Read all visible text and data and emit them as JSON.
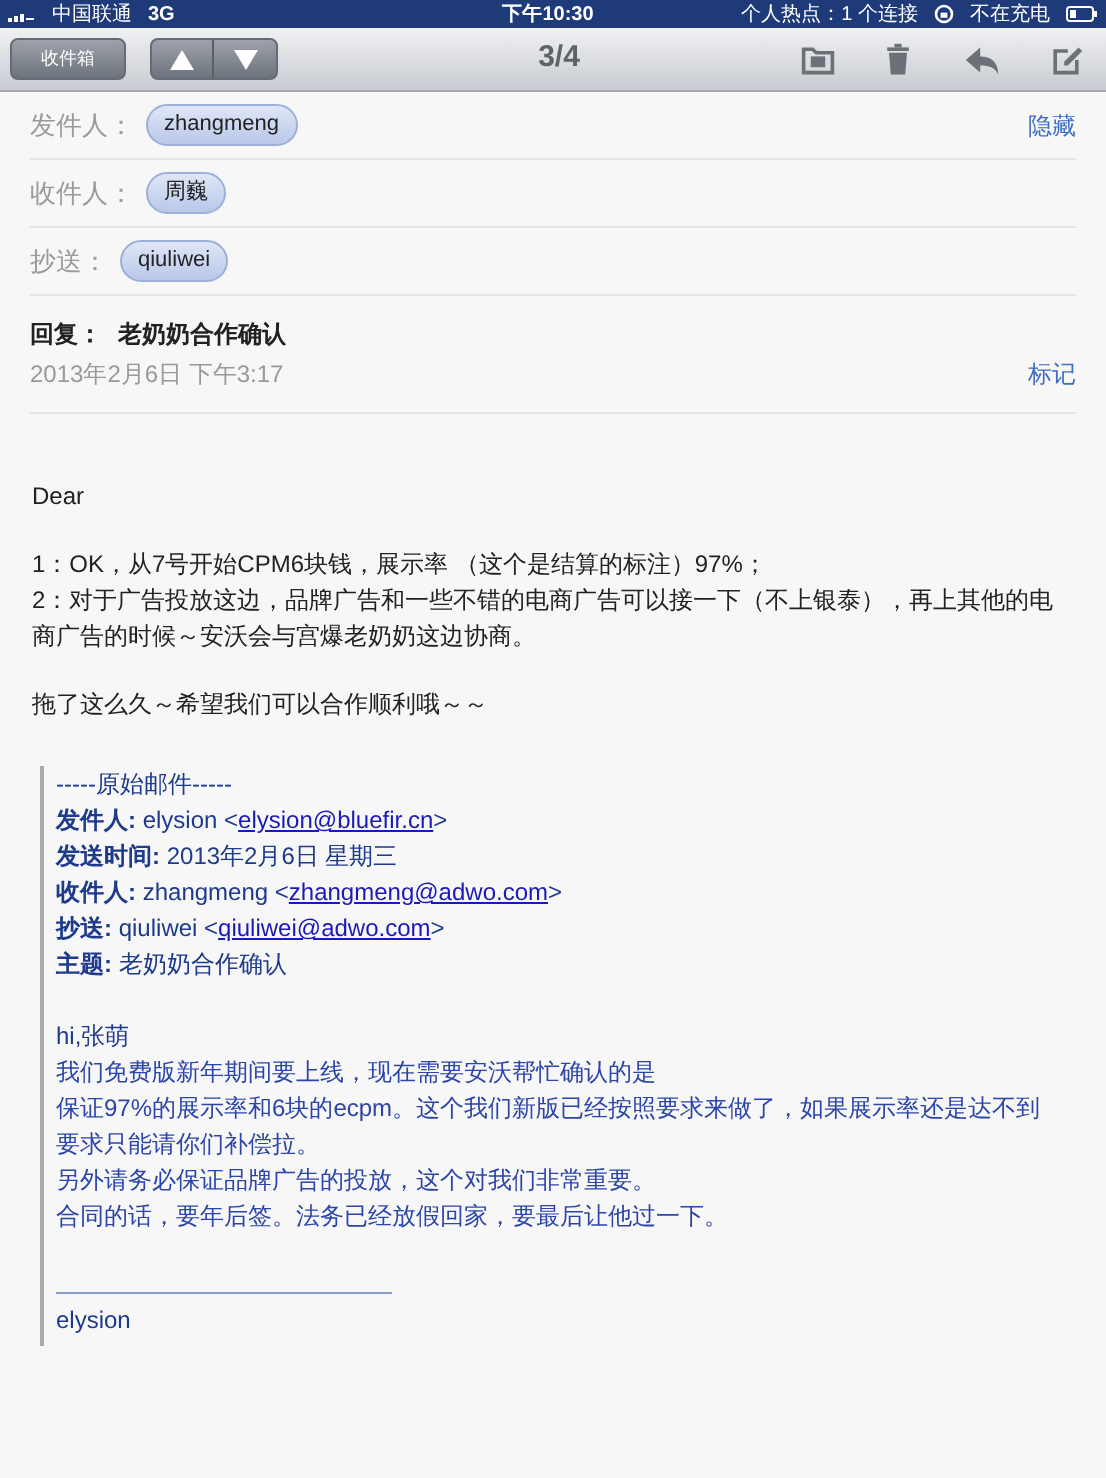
{
  "status_bar": {
    "carrier": "中国联通",
    "network": "3G",
    "time": "下午10:30",
    "hotspot": "个人热点：1 个连接",
    "charging": "不在充电"
  },
  "toolbar": {
    "mailbox_button": "收件箱",
    "counter": "3/4"
  },
  "header": {
    "recipients": [
      {
        "label": "发件人：",
        "name": "zhangmeng"
      },
      {
        "label": "收件人：",
        "name": "周巍"
      },
      {
        "label": "抄送：",
        "name": "qiuliwei"
      }
    ],
    "hide_link": "隐藏",
    "subject_label": "回复：",
    "subject": "老奶奶合作确认",
    "date": "2013年2月6日 下午3:17",
    "mark_link": "标记"
  },
  "body": {
    "paragraphs": [
      "Dear",
      "1：OK，从7号开始CPM6块钱，展示率 （这个是结算的标注）97%；",
      "2：对于广告投放这边，品牌广告和一些不错的电商广告可以接一下（不上银泰），再上其他的电商广告的时候～安沃会与宫爆老奶奶这边协商。",
      "拖了这么久～希望我们可以合作顺利哦～～"
    ]
  },
  "quoted": {
    "title": "-----原始邮件-----",
    "fields": [
      {
        "label": "发件人:",
        "text": "elysion <",
        "link": "elysion@bluefir.cn",
        "after": ">"
      },
      {
        "label": "发送时间:",
        "text": "2013年2月6日 星期三"
      },
      {
        "label": "收件人:",
        "text": "zhangmeng <",
        "link": "zhangmeng@adwo.com",
        "after": ">"
      },
      {
        "label": "抄送:",
        "text": "qiuliwei <",
        "link": "qiuliwei@adwo.com",
        "after": ">"
      },
      {
        "label": "主题:",
        "text": "老奶奶合作确认"
      }
    ],
    "greeting": "hi,张萌",
    "lines": [
      "我们免费版新年期间要上线，现在需要安沃帮忙确认的是",
      "保证97%的展示率和6块的ecpm。这个我们新版已经按照要求来做了，如果展示率还是达不到要求只能请你们补偿拉。",
      "另外请务必保证品牌广告的投放，这个对我们非常重要。",
      "合同的话，要年后签。法务已经放假回家，要最后让他过一下。"
    ],
    "signature": "elysion"
  }
}
